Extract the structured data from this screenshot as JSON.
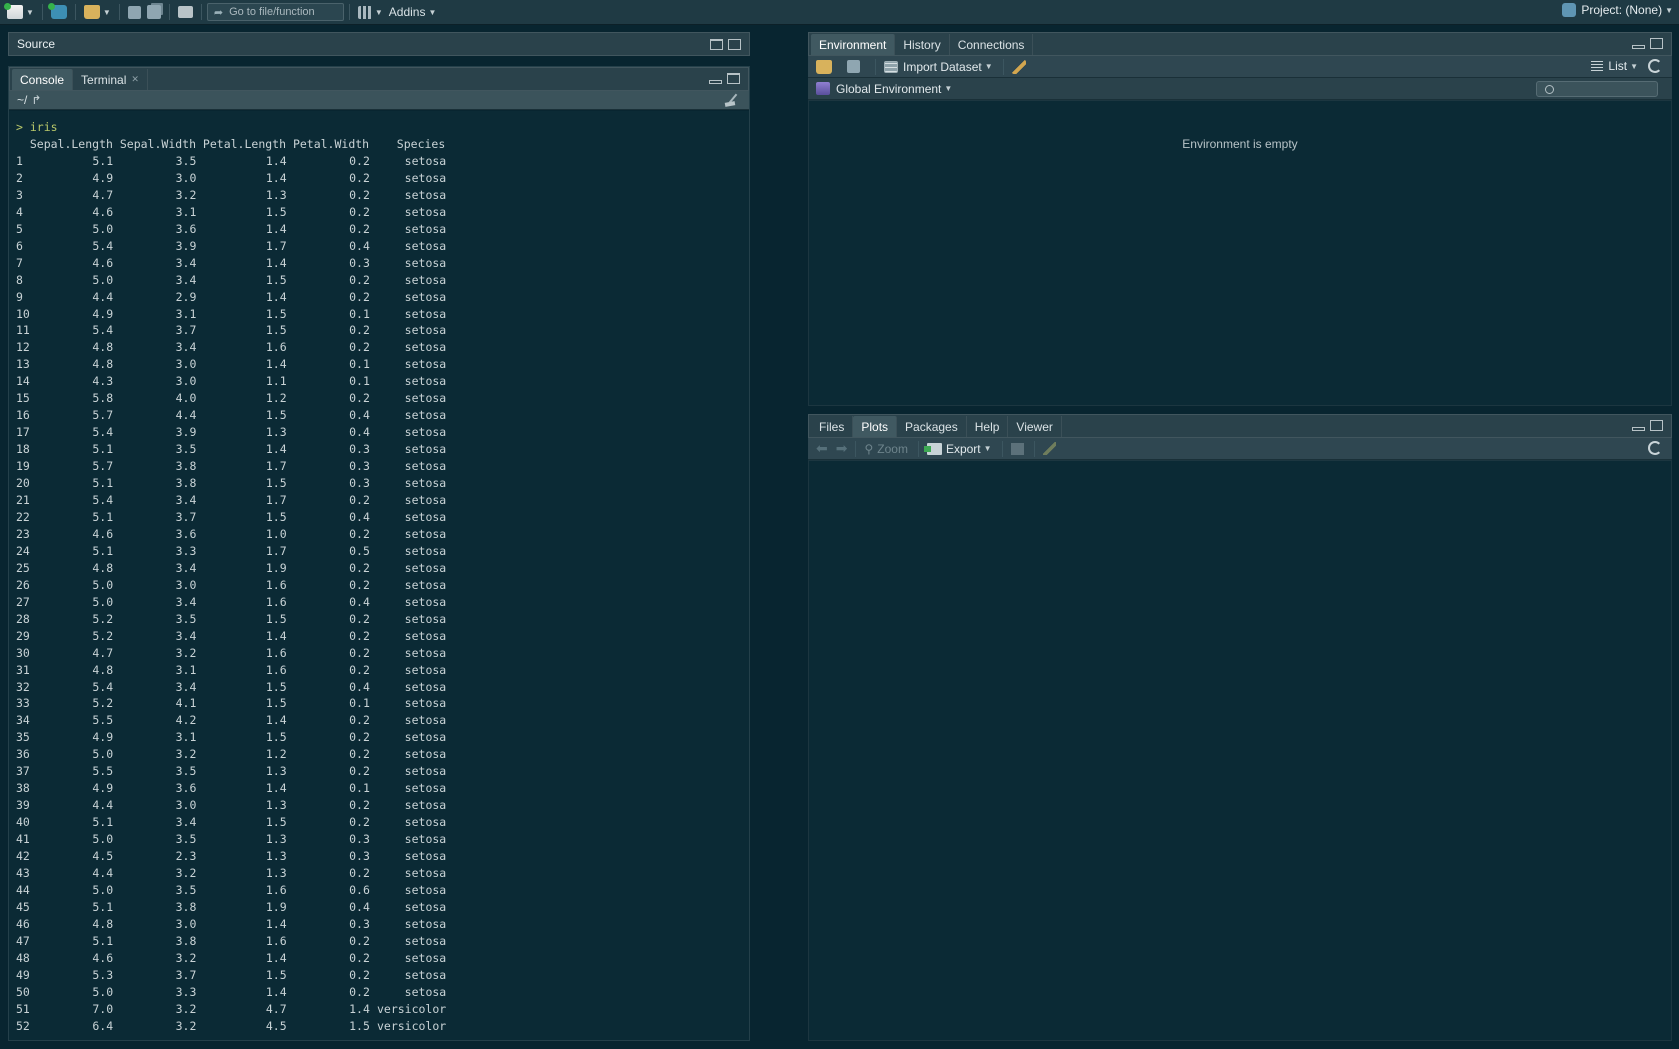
{
  "toolbar": {
    "goto_placeholder": "Go to file/function",
    "addins_label": "Addins",
    "project_label": "Project: (None)"
  },
  "source": {
    "title": "Source"
  },
  "console": {
    "tabs": [
      {
        "label": "Console",
        "active": true
      },
      {
        "label": "Terminal",
        "active": false,
        "closable": true
      }
    ],
    "path": "~/",
    "command": "iris",
    "header": "  Sepal.Length Sepal.Width Petal.Length Petal.Width    Species",
    "columns": [
      "Sepal.Length",
      "Sepal.Width",
      "Petal.Length",
      "Petal.Width",
      "Species"
    ],
    "rows": [
      [
        "1",
        "5.1",
        "3.5",
        "1.4",
        "0.2",
        "setosa"
      ],
      [
        "2",
        "4.9",
        "3.0",
        "1.4",
        "0.2",
        "setosa"
      ],
      [
        "3",
        "4.7",
        "3.2",
        "1.3",
        "0.2",
        "setosa"
      ],
      [
        "4",
        "4.6",
        "3.1",
        "1.5",
        "0.2",
        "setosa"
      ],
      [
        "5",
        "5.0",
        "3.6",
        "1.4",
        "0.2",
        "setosa"
      ],
      [
        "6",
        "5.4",
        "3.9",
        "1.7",
        "0.4",
        "setosa"
      ],
      [
        "7",
        "4.6",
        "3.4",
        "1.4",
        "0.3",
        "setosa"
      ],
      [
        "8",
        "5.0",
        "3.4",
        "1.5",
        "0.2",
        "setosa"
      ],
      [
        "9",
        "4.4",
        "2.9",
        "1.4",
        "0.2",
        "setosa"
      ],
      [
        "10",
        "4.9",
        "3.1",
        "1.5",
        "0.1",
        "setosa"
      ],
      [
        "11",
        "5.4",
        "3.7",
        "1.5",
        "0.2",
        "setosa"
      ],
      [
        "12",
        "4.8",
        "3.4",
        "1.6",
        "0.2",
        "setosa"
      ],
      [
        "13",
        "4.8",
        "3.0",
        "1.4",
        "0.1",
        "setosa"
      ],
      [
        "14",
        "4.3",
        "3.0",
        "1.1",
        "0.1",
        "setosa"
      ],
      [
        "15",
        "5.8",
        "4.0",
        "1.2",
        "0.2",
        "setosa"
      ],
      [
        "16",
        "5.7",
        "4.4",
        "1.5",
        "0.4",
        "setosa"
      ],
      [
        "17",
        "5.4",
        "3.9",
        "1.3",
        "0.4",
        "setosa"
      ],
      [
        "18",
        "5.1",
        "3.5",
        "1.4",
        "0.3",
        "setosa"
      ],
      [
        "19",
        "5.7",
        "3.8",
        "1.7",
        "0.3",
        "setosa"
      ],
      [
        "20",
        "5.1",
        "3.8",
        "1.5",
        "0.3",
        "setosa"
      ],
      [
        "21",
        "5.4",
        "3.4",
        "1.7",
        "0.2",
        "setosa"
      ],
      [
        "22",
        "5.1",
        "3.7",
        "1.5",
        "0.4",
        "setosa"
      ],
      [
        "23",
        "4.6",
        "3.6",
        "1.0",
        "0.2",
        "setosa"
      ],
      [
        "24",
        "5.1",
        "3.3",
        "1.7",
        "0.5",
        "setosa"
      ],
      [
        "25",
        "4.8",
        "3.4",
        "1.9",
        "0.2",
        "setosa"
      ],
      [
        "26",
        "5.0",
        "3.0",
        "1.6",
        "0.2",
        "setosa"
      ],
      [
        "27",
        "5.0",
        "3.4",
        "1.6",
        "0.4",
        "setosa"
      ],
      [
        "28",
        "5.2",
        "3.5",
        "1.5",
        "0.2",
        "setosa"
      ],
      [
        "29",
        "5.2",
        "3.4",
        "1.4",
        "0.2",
        "setosa"
      ],
      [
        "30",
        "4.7",
        "3.2",
        "1.6",
        "0.2",
        "setosa"
      ],
      [
        "31",
        "4.8",
        "3.1",
        "1.6",
        "0.2",
        "setosa"
      ],
      [
        "32",
        "5.4",
        "3.4",
        "1.5",
        "0.4",
        "setosa"
      ],
      [
        "33",
        "5.2",
        "4.1",
        "1.5",
        "0.1",
        "setosa"
      ],
      [
        "34",
        "5.5",
        "4.2",
        "1.4",
        "0.2",
        "setosa"
      ],
      [
        "35",
        "4.9",
        "3.1",
        "1.5",
        "0.2",
        "setosa"
      ],
      [
        "36",
        "5.0",
        "3.2",
        "1.2",
        "0.2",
        "setosa"
      ],
      [
        "37",
        "5.5",
        "3.5",
        "1.3",
        "0.2",
        "setosa"
      ],
      [
        "38",
        "4.9",
        "3.6",
        "1.4",
        "0.1",
        "setosa"
      ],
      [
        "39",
        "4.4",
        "3.0",
        "1.3",
        "0.2",
        "setosa"
      ],
      [
        "40",
        "5.1",
        "3.4",
        "1.5",
        "0.2",
        "setosa"
      ],
      [
        "41",
        "5.0",
        "3.5",
        "1.3",
        "0.3",
        "setosa"
      ],
      [
        "42",
        "4.5",
        "2.3",
        "1.3",
        "0.3",
        "setosa"
      ],
      [
        "43",
        "4.4",
        "3.2",
        "1.3",
        "0.2",
        "setosa"
      ],
      [
        "44",
        "5.0",
        "3.5",
        "1.6",
        "0.6",
        "setosa"
      ],
      [
        "45",
        "5.1",
        "3.8",
        "1.9",
        "0.4",
        "setosa"
      ],
      [
        "46",
        "4.8",
        "3.0",
        "1.4",
        "0.3",
        "setosa"
      ],
      [
        "47",
        "5.1",
        "3.8",
        "1.6",
        "0.2",
        "setosa"
      ],
      [
        "48",
        "4.6",
        "3.2",
        "1.4",
        "0.2",
        "setosa"
      ],
      [
        "49",
        "5.3",
        "3.7",
        "1.5",
        "0.2",
        "setosa"
      ],
      [
        "50",
        "5.0",
        "3.3",
        "1.4",
        "0.2",
        "setosa"
      ],
      [
        "51",
        "7.0",
        "3.2",
        "4.7",
        "1.4",
        "versicolor"
      ],
      [
        "52",
        "6.4",
        "3.2",
        "4.5",
        "1.5",
        "versicolor"
      ]
    ]
  },
  "environment": {
    "tabs": [
      {
        "label": "Environment",
        "active": true
      },
      {
        "label": "History",
        "active": false
      },
      {
        "label": "Connections",
        "active": false
      }
    ],
    "import_label": "Import Dataset",
    "list_label": "List",
    "scope_label": "Global Environment",
    "empty_message": "Environment is empty"
  },
  "plots": {
    "tabs": [
      {
        "label": "Files",
        "active": false
      },
      {
        "label": "Plots",
        "active": true
      },
      {
        "label": "Packages",
        "active": false
      },
      {
        "label": "Help",
        "active": false
      },
      {
        "label": "Viewer",
        "active": false
      }
    ],
    "zoom_label": "Zoom",
    "export_label": "Export"
  },
  "colors": {
    "background": "#082530",
    "pane_header": "#2a424b",
    "console_text": "#c9d3d6",
    "prompt": "#b9c86a"
  }
}
